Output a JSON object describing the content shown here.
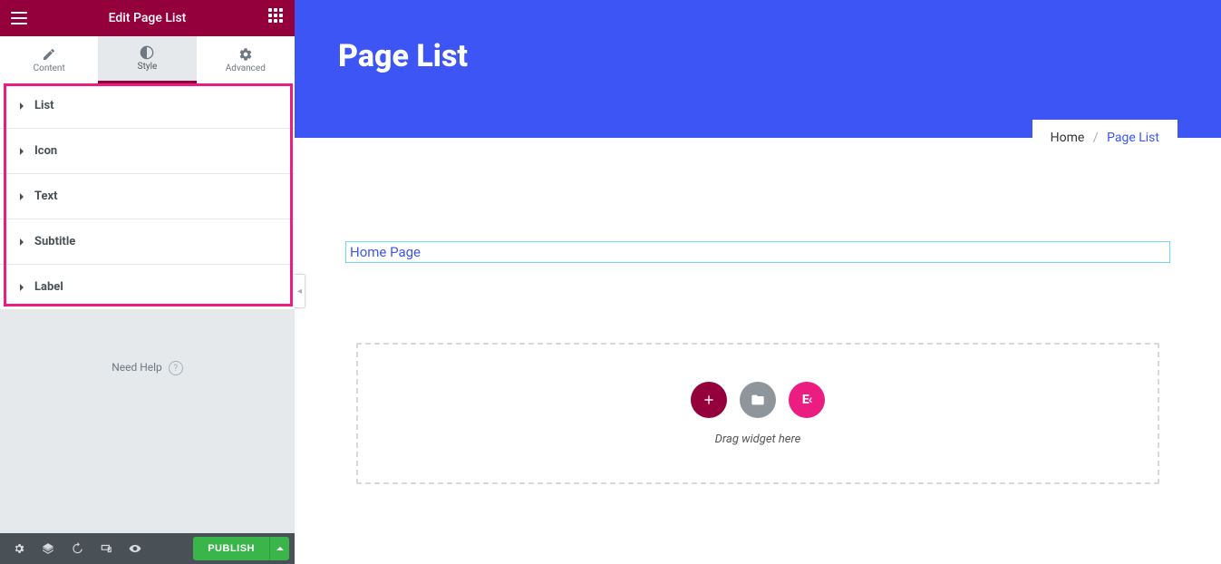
{
  "sidebar": {
    "title": "Edit Page List",
    "tabs": {
      "content": "Content",
      "style": "Style",
      "advanced": "Advanced",
      "active": "style"
    },
    "sections": [
      "List",
      "Icon",
      "Text",
      "Subtitle",
      "Label"
    ],
    "need_help": "Need Help"
  },
  "footer": {
    "publish": "PUBLISH"
  },
  "canvas": {
    "hero_title": "Page List",
    "breadcrumb": {
      "home": "Home",
      "current": "Page List"
    },
    "widget_link": "Home Page",
    "drop_text": "Drag widget here",
    "ek_label": "E‹"
  }
}
